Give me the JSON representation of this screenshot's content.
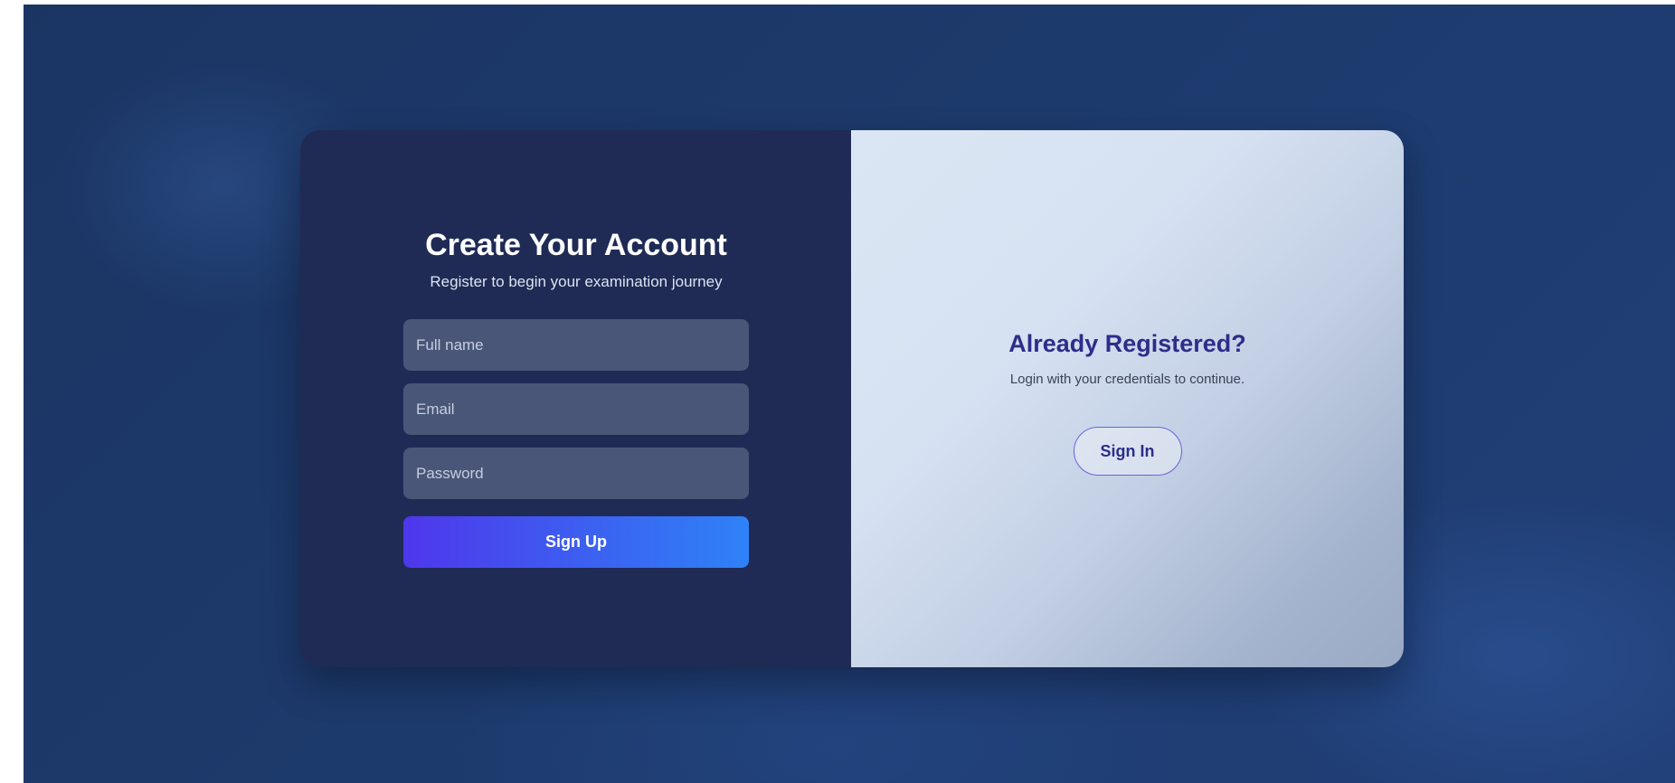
{
  "register": {
    "title": "Create Your Account",
    "subtitle": "Register to begin your examination journey",
    "fields": {
      "full_name_placeholder": "Full name",
      "email_placeholder": "Email",
      "password_placeholder": "Password"
    },
    "submit_label": "Sign Up"
  },
  "login_prompt": {
    "title": "Already Registered?",
    "text": "Login with your credentials to continue.",
    "button_label": "Sign In"
  },
  "colors": {
    "background": "#1d3a6c",
    "left_panel": "#1f2b55",
    "input_fill": "#4a5677",
    "button_gradient_start": "#4f37ec",
    "button_gradient_end": "#2f82f7",
    "heading_accent": "#2e2d8a"
  }
}
